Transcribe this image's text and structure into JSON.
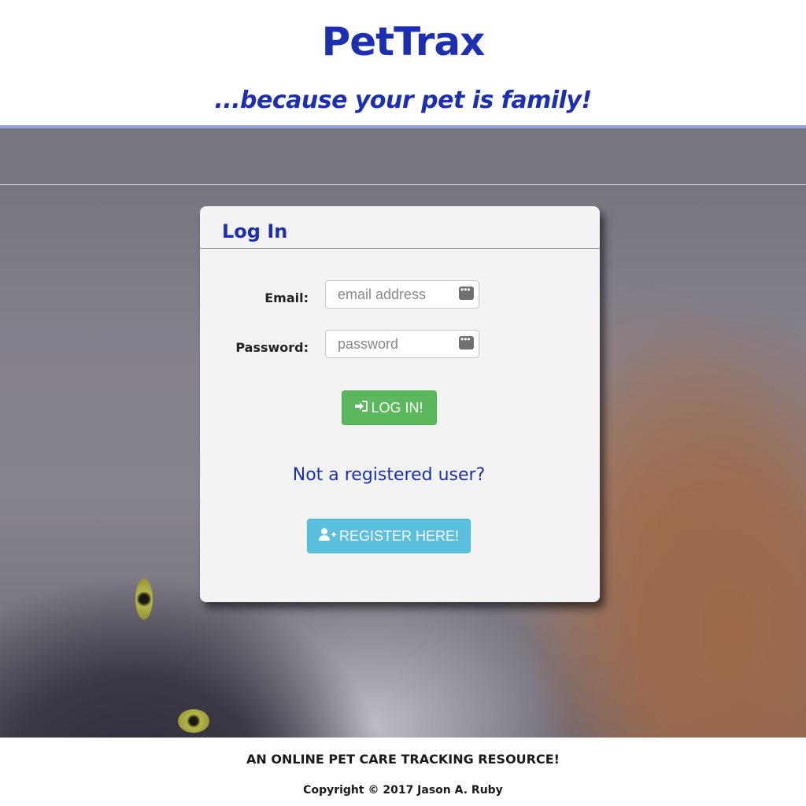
{
  "header": {
    "brand": "PetTrax",
    "tagline": "...because your pet is family!"
  },
  "login": {
    "title": "Log In",
    "email_label": "Email:",
    "email_placeholder": "email address",
    "email_value": "",
    "password_label": "Password:",
    "password_placeholder": "password",
    "password_value": "",
    "login_button": "LOG IN!",
    "login_icon": "sign-in-icon",
    "register_prompt": "Not a registered user?",
    "register_button": "REGISTER HERE!",
    "register_icon": "user-plus-icon",
    "field_icon": "password-manager-key-icon"
  },
  "footer": {
    "slogan": "AN ONLINE PET CARE TRACKING RESOURCE!",
    "copyright": "Copyright © 2017 Jason A. Ruby"
  },
  "colors": {
    "brand_blue": "#1c2fb3",
    "login_green": "#5cb85c",
    "register_cyan": "#5bc0de"
  }
}
